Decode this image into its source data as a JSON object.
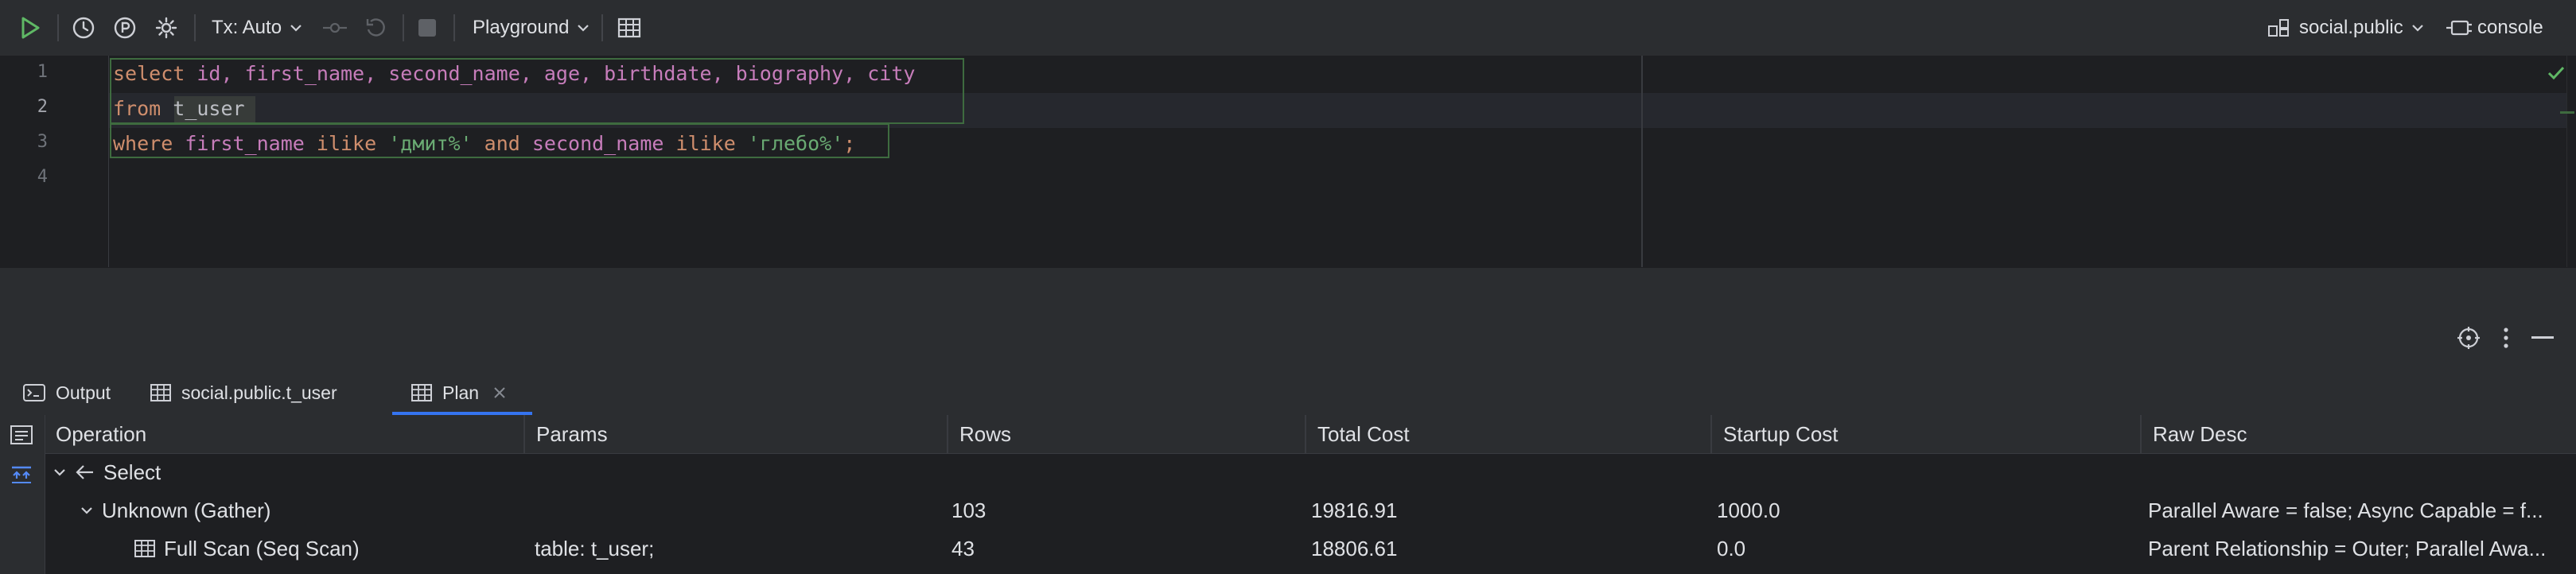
{
  "toolbar": {
    "tx_mode": "Tx: Auto",
    "session": "Playground",
    "schema": "social.public",
    "console": "console"
  },
  "editor": {
    "line_numbers": [
      "1",
      "2",
      "3",
      "4"
    ],
    "line1": {
      "kw": "select",
      "cols": "id, first_name, second_name, age, birthdate, biography, city"
    },
    "line2": {
      "kw": "from",
      "table": "t_user"
    },
    "line3": {
      "kw_where": "where",
      "col1": "first_name",
      "kw_ilike1": "ilike",
      "str1": "'дмит%'",
      "kw_and": "and",
      "col2": "second_name",
      "kw_ilike2": "ilike",
      "str2": "'глебо%'",
      "semi": ";"
    }
  },
  "tabs": [
    {
      "label": "Output"
    },
    {
      "label": "social.public.t_user"
    },
    {
      "label": "Plan"
    }
  ],
  "grid": {
    "columns": [
      "Operation",
      "Params",
      "Rows",
      "Total Cost",
      "Startup Cost",
      "Raw Desc"
    ],
    "rows": [
      {
        "operation": "Select",
        "params": "",
        "rows": "",
        "total_cost": "",
        "startup_cost": "",
        "raw_desc": ""
      },
      {
        "operation": "Unknown (Gather)",
        "params": "",
        "rows": "103",
        "total_cost": "19816.91",
        "startup_cost": "1000.0",
        "raw_desc": "Parallel Aware = false; Async Capable = f..."
      },
      {
        "operation": "Full Scan (Seq Scan)",
        "params": "table: t_user;",
        "rows": "43",
        "total_cost": "18806.61",
        "startup_cost": "0.0",
        "raw_desc": "Parent Relationship = Outer; Parallel Awa..."
      }
    ]
  },
  "colors": {
    "run_green": "#5fb865",
    "keyword": "#cf8e6d",
    "column": "#c77dbb",
    "string": "#6aab73",
    "accent": "#3574f0"
  }
}
